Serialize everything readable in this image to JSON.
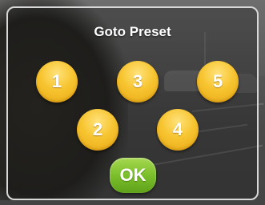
{
  "dialog": {
    "title": "Goto Preset",
    "presets": [
      "1",
      "2",
      "3",
      "4",
      "5"
    ],
    "ok_label": "OK"
  },
  "colors": {
    "preset_button": "#f7c531",
    "ok_button": "#7bbf2c",
    "text": "#ffffff"
  }
}
